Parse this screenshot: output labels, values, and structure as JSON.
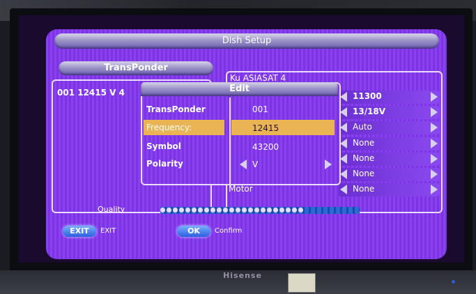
{
  "tv": {
    "brand": "Hisense"
  },
  "menu": {
    "title": "Dish Setup",
    "transponder_header": "TransPonder",
    "transponder_row": "001 12415 V 4",
    "satellite": "Ku ASIASAT 4",
    "right_values": [
      "11300",
      "13/18V",
      "Auto",
      "None",
      "None",
      "None",
      "None"
    ],
    "motor_label": "Motor"
  },
  "edit_dialog": {
    "title": "Edit",
    "fields": [
      {
        "label": "TransPonder",
        "value": "001"
      },
      {
        "label": "Frequency:",
        "value": "12415"
      },
      {
        "label": "Symbol",
        "value": "43200"
      },
      {
        "label": "Polarity",
        "value": "V"
      }
    ]
  },
  "quality": {
    "label": "Quality",
    "level": 0.72
  },
  "footer": {
    "exit_button": "EXIT",
    "exit_text": "EXIT",
    "ok_button": "OK",
    "ok_text": "Confirm"
  },
  "colors": {
    "panel": "#8a41f0",
    "highlight": "#eab354",
    "quality_bar": "#2a6ad8"
  }
}
